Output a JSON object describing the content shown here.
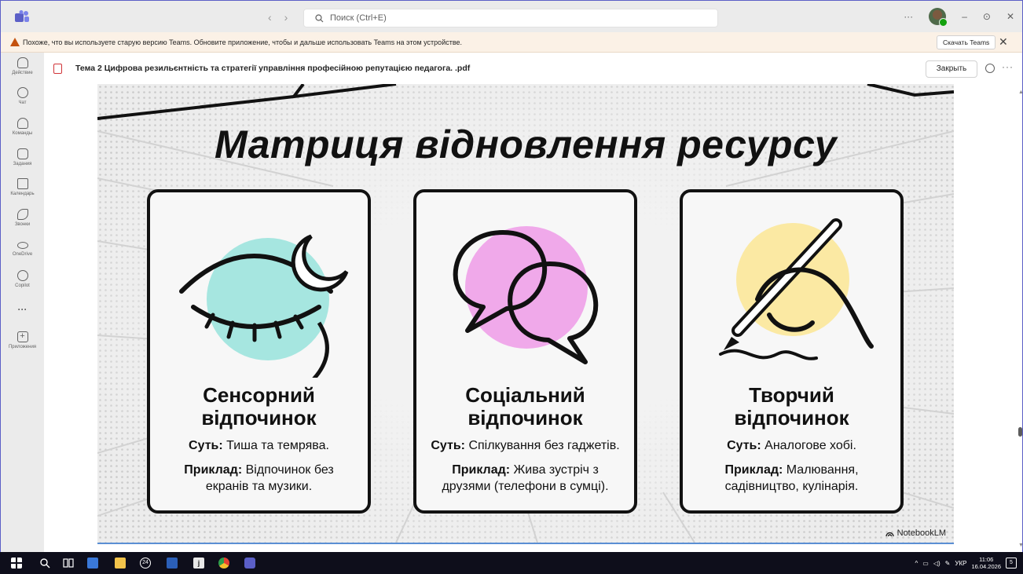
{
  "window": {
    "search_placeholder": "Поиск (Ctrl+E)",
    "nav_back": "‹",
    "nav_forward": "›",
    "more": "···",
    "minimize": "–",
    "restore": "⊙",
    "close": "✕"
  },
  "banner": {
    "message": "Похоже, что вы используете старую версию Teams. Обновите приложение, чтобы и дальше использовать Teams на этом устройстве.",
    "button_label": "Скачать Teams",
    "close_label": "✕"
  },
  "rail": {
    "items": [
      {
        "label": "Действие",
        "icon": "bell-icon"
      },
      {
        "label": "Чат",
        "icon": "chat-icon"
      },
      {
        "label": "Команды",
        "icon": "teams-icon"
      },
      {
        "label": "Задания",
        "icon": "assignments-icon"
      },
      {
        "label": "Календарь",
        "icon": "calendar-icon"
      },
      {
        "label": "Звонки",
        "icon": "phone-icon"
      },
      {
        "label": "OneDrive",
        "icon": "cloud-icon"
      },
      {
        "label": "Copilot",
        "icon": "copilot-icon"
      },
      {
        "label": "···",
        "icon": "more-icon"
      },
      {
        "label": "Приложения",
        "icon": "add-apps-icon"
      }
    ]
  },
  "document": {
    "title": "Тема 2 Цифрова резильєнтність та стратегії управління професійною репутацією педагога. .pdf",
    "close_label": "Закрыть",
    "more": "···"
  },
  "slide": {
    "title": "Матриця відновлення ресурсу",
    "watermark": "NotebookLM",
    "cards": [
      {
        "heading_line1": "Сенсорний",
        "heading_line2": "відпочинок",
        "essence_label": "Суть:",
        "essence": "Тиша та темрява.",
        "example_label": "Приклад:",
        "example_line1": "Відпочинок без",
        "example_line2": "екранів та музики.",
        "accent": "#a6e6e0"
      },
      {
        "heading_line1": "Соціальний",
        "heading_line2": "відпочинок",
        "essence_label": "Суть:",
        "essence": "Спілкування без гаджетів.",
        "example_label": "Приклад:",
        "example_line1": "Жива зустріч з",
        "example_line2": "друзями (телефони в сумці).",
        "accent": "#f0a9ea"
      },
      {
        "heading_line1": "Творчий",
        "heading_line2": "відпочинок",
        "essence_label": "Суть:",
        "essence": "Аналогове хобі.",
        "example_label": "Приклад:",
        "example_line1": "Малювання,",
        "example_line2": "садівництво, кулінарія.",
        "accent": "#fbe9a3"
      }
    ]
  },
  "taskbar": {
    "badge": "24",
    "language": "УКР",
    "time": "11:06",
    "date": "16.04.2026",
    "notifications": "5"
  }
}
